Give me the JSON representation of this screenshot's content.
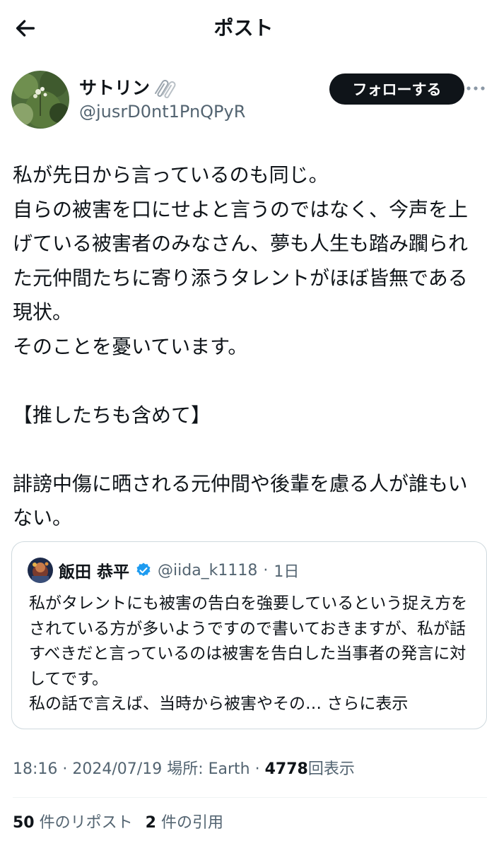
{
  "header": {
    "title": "ポスト"
  },
  "author": {
    "name": "サトリン",
    "handle": "@jusrD0nt1PnQPyR",
    "follow_label": "フォローする"
  },
  "post": {
    "text": "私が先日から言っているのも同じ。\n自らの被害を口にせよと言うのではなく、今声を上げている被害者のみなさん、夢も人生も踏み躙られた元仲間たちに寄り添うタレントがほぼ皆無である現状。\nそのことを憂いています。\n\n【推したちも含めて】\n\n誹謗中傷に晒される元仲間や後輩を慮る人が誰もいない。"
  },
  "quote": {
    "name": "飯田 恭平",
    "handle": "@iida_k1118",
    "separator": "·",
    "time": "1日",
    "text": "私がタレントにも被害の告白を強要しているという捉え方をされている方が多いようですので書いておきますが、私が話すべきだと言っているのは被害を告白した当事者の発言に対してです。\n私の話で言えば、当時から被害やその…",
    "show_more": "さらに表示"
  },
  "meta": {
    "time": "18:16",
    "sep1": "·",
    "date": "2024/07/19",
    "location": "場所: Earth",
    "sep2": "·",
    "views_count": "4778",
    "views_label": "回表示"
  },
  "stats": {
    "reposts_count": "50",
    "reposts_label": "件のリポスト",
    "quotes_count": "2",
    "quotes_label": "件の引用"
  },
  "colors": {
    "text": "#0f1419",
    "secondary": "#536471",
    "verified": "#1d9bf0",
    "border": "#cfd9de"
  },
  "icons": [
    "back-arrow-icon",
    "paperclip-icon",
    "more-icon",
    "verified-badge-icon"
  ]
}
